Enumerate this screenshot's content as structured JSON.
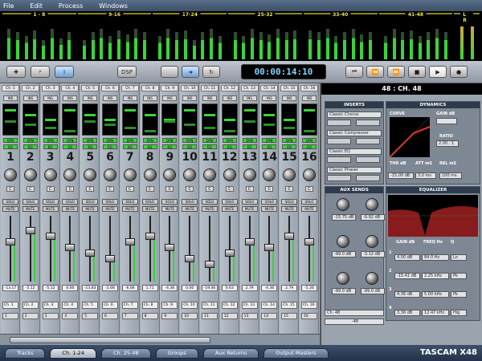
{
  "menu": [
    "File",
    "Edit",
    "Process",
    "Windows"
  ],
  "meter_groups": [
    {
      "label": "1 - 8",
      "levels": [
        0.8,
        0.7,
        0.6,
        0.75,
        0.5,
        0.8,
        0.55,
        0.7
      ]
    },
    {
      "label": "9-16",
      "levels": [
        0.5,
        0.7,
        0.8,
        0.6,
        0.75,
        0.65,
        0.8,
        0.7
      ]
    },
    {
      "label": "17-24",
      "levels": [
        0.6,
        0.8,
        0.7,
        0.75,
        0.5,
        0.7,
        0.8,
        0.6
      ]
    },
    {
      "label": "25-32",
      "levels": [
        0.7,
        0.6,
        0.8,
        0.7,
        0.65,
        0.8,
        0.7,
        0.75
      ]
    },
    {
      "label": "33-40",
      "levels": [
        0.75,
        0.7,
        0.8,
        0.6,
        0.7,
        0.8,
        0.65,
        0.7
      ]
    },
    {
      "label": "41-48",
      "levels": [
        0.6,
        0.8,
        0.7,
        0.75,
        0.6,
        0.7,
        0.8,
        0.7
      ]
    },
    {
      "label": "L R",
      "levels": [
        0.85,
        0.85
      ]
    }
  ],
  "transport": {
    "dsp": "DSP",
    "timecode": "00:00:14:10"
  },
  "channels": [
    {
      "label": "Ch. 1",
      "num": "1",
      "val": "-13.17",
      "name": "Ch. 1",
      "sel": "1",
      "level": 0.6
    },
    {
      "label": "Ch. 2",
      "num": "2",
      "val": "-5.12",
      "name": "Ch. 2",
      "sel": "2",
      "level": 0.8
    },
    {
      "label": "Ch. 3",
      "num": "3",
      "val": "-5.12",
      "name": "Ch. 3",
      "sel": "3",
      "level": 0.7
    },
    {
      "label": "Ch. 4",
      "num": "4",
      "val": "0.00",
      "name": "Ch. 4",
      "sel": "4",
      "level": 0.5
    },
    {
      "label": "Ch. 5",
      "num": "5",
      "val": "-13.83",
      "name": "Ch. 5",
      "sel": "5",
      "level": 0.4
    },
    {
      "label": "Ch. 6",
      "num": "6",
      "val": "-2.66",
      "name": "Ch. 6",
      "sel": "6",
      "level": 0.3
    },
    {
      "label": "Ch. 7",
      "num": "7",
      "val": "-6.06",
      "name": "Ch. 7",
      "sel": "7",
      "level": 0.6
    },
    {
      "label": "Ch. 8",
      "num": "8",
      "val": "1.71",
      "name": "Ch. 8",
      "sel": "8",
      "level": 0.7
    },
    {
      "label": "Ch. 9",
      "num": "9",
      "val": "-4.36",
      "name": "Ch. 9",
      "sel": "9",
      "level": 0.5
    },
    {
      "label": "Ch. 10",
      "num": "10",
      "val": "0.00",
      "name": "Ch. 10",
      "sel": "10",
      "level": 0.3
    },
    {
      "label": "Ch. 11",
      "num": "11",
      "val": "-19.06",
      "name": "Ch. 11",
      "sel": "11",
      "level": 0.2
    },
    {
      "label": "Ch. 12",
      "num": "12",
      "val": "0.63",
      "name": "Ch. 12",
      "sel": "12",
      "level": 0.4
    },
    {
      "label": "Ch. 13",
      "num": "13",
      "val": "2.79",
      "name": "Ch. 13",
      "sel": "13",
      "level": 0.6
    },
    {
      "label": "Ch. 14",
      "num": "14",
      "val": "-4.36",
      "name": "Ch. 14",
      "sel": "14",
      "level": 0.5
    },
    {
      "label": "Ch. 15",
      "num": "15",
      "val": "2.79",
      "name": "Ch. 15",
      "sel": "15",
      "level": 0.7
    },
    {
      "label": "Ch. 16",
      "num": "16",
      "val": "-5.26",
      "name": "Ch. 16",
      "sel": "16",
      "level": 0.6
    }
  ],
  "strip_labels": {
    "ins": "INS",
    "dyn": "DYN",
    "eq": "EQ",
    "c": "C",
    "solo": "SOLO",
    "mute": "MUTE"
  },
  "panel": {
    "title": "48 : CH. 48",
    "inserts_title": "INSERTS",
    "inserts": [
      "Classic Chorus",
      "Classic Compressor",
      "Classic EQ",
      "Classic Phaser"
    ],
    "dynamics_title": "DYNAMICS",
    "curve": "CURVE",
    "gain_db": "GAIN dB",
    "ratio": "RATIO",
    "ratio_val": "2.00 : 1",
    "thr": "THR dB",
    "att": "ATT mS",
    "rel": "REL mS",
    "thr_val": "-15.00 dB",
    "att_val": "3.0 ms",
    "rel_val": "100 ms",
    "aux_title": "AUX SENDS",
    "aux_vals": [
      "-15.75 dB",
      "-9.92 dB",
      "-99.0 dB",
      "-3.12 dB",
      "-99.0 dB",
      "-99.0 dB"
    ],
    "eq_title": "EQUALIZER",
    "eq_cols": [
      "GAIN dB",
      "FREQ Hz",
      "Q"
    ],
    "eq_rows": [
      {
        "n": "1",
        "gain": "4.00 dB",
        "freq": "84.0 Hz",
        "q": "Lo"
      },
      {
        "n": "2",
        "gain": "-15.41 dB",
        "freq": "2.25 kHz",
        "q": "Pk"
      },
      {
        "n": "3",
        "gain": "4.36 dB",
        "freq": "5.00 kHz",
        "q": "Pk"
      },
      {
        "n": "4",
        "gain": "3.36 dB",
        "freq": "12.47 kHz",
        "q": "Hig"
      }
    ],
    "channel_name": "Ch. 48",
    "channel_val": "-48"
  },
  "tabs": [
    {
      "label": "Tracks",
      "active": false
    },
    {
      "label": "Ch. 1-24",
      "active": true
    },
    {
      "label": "Ch. 25-48",
      "active": false
    },
    {
      "label": "Groups",
      "active": false
    },
    {
      "label": "Aux Returns",
      "active": false
    },
    {
      "label": "Output Masters",
      "active": false
    }
  ],
  "brand": "TASCAM X48"
}
